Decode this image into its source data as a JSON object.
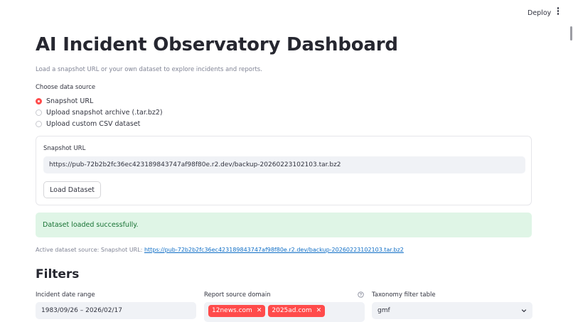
{
  "header": {
    "deploy_label": "Deploy",
    "menu_icon": "kebab-menu-icon"
  },
  "page": {
    "title": "AI Incident Observatory Dashboard",
    "subtitle": "Load a snapshot URL or your own dataset to explore incidents and reports."
  },
  "data_source": {
    "label": "Choose data source",
    "options": [
      "Snapshot URL",
      "Upload snapshot archive (.tar.bz2)",
      "Upload custom CSV dataset"
    ],
    "selected": "Snapshot URL"
  },
  "snapshot": {
    "label": "Snapshot URL",
    "value": "https://pub-72b2b2fc36ec423189843747af98f80e.r2.dev/backup-20260223102103.tar.bz2",
    "button_label": "Load Dataset"
  },
  "status": {
    "success_message": "Dataset loaded successfully.",
    "active_prefix": "Active dataset source: Snapshot URL: ",
    "active_link": "https://pub-72b2b2fc36ec423189843747af98f80e.r2.dev/backup-20260223102103.tar.bz2"
  },
  "filters": {
    "heading": "Filters",
    "date_range": {
      "label": "Incident date range",
      "value": "1983/09/26 – 2026/02/17"
    },
    "domain": {
      "label": "Report source domain",
      "tags": [
        "12news.com",
        "2025ad.com"
      ],
      "help_icon": "help-circle-icon"
    },
    "taxonomy": {
      "label": "Taxonomy filter table",
      "value": "gmf",
      "icon": "chevron-down-icon"
    }
  },
  "colors": {
    "accent": "#ff4b4b",
    "success_bg": "#dff5e6",
    "success_text": "#177233",
    "link": "#0f6ec6"
  }
}
